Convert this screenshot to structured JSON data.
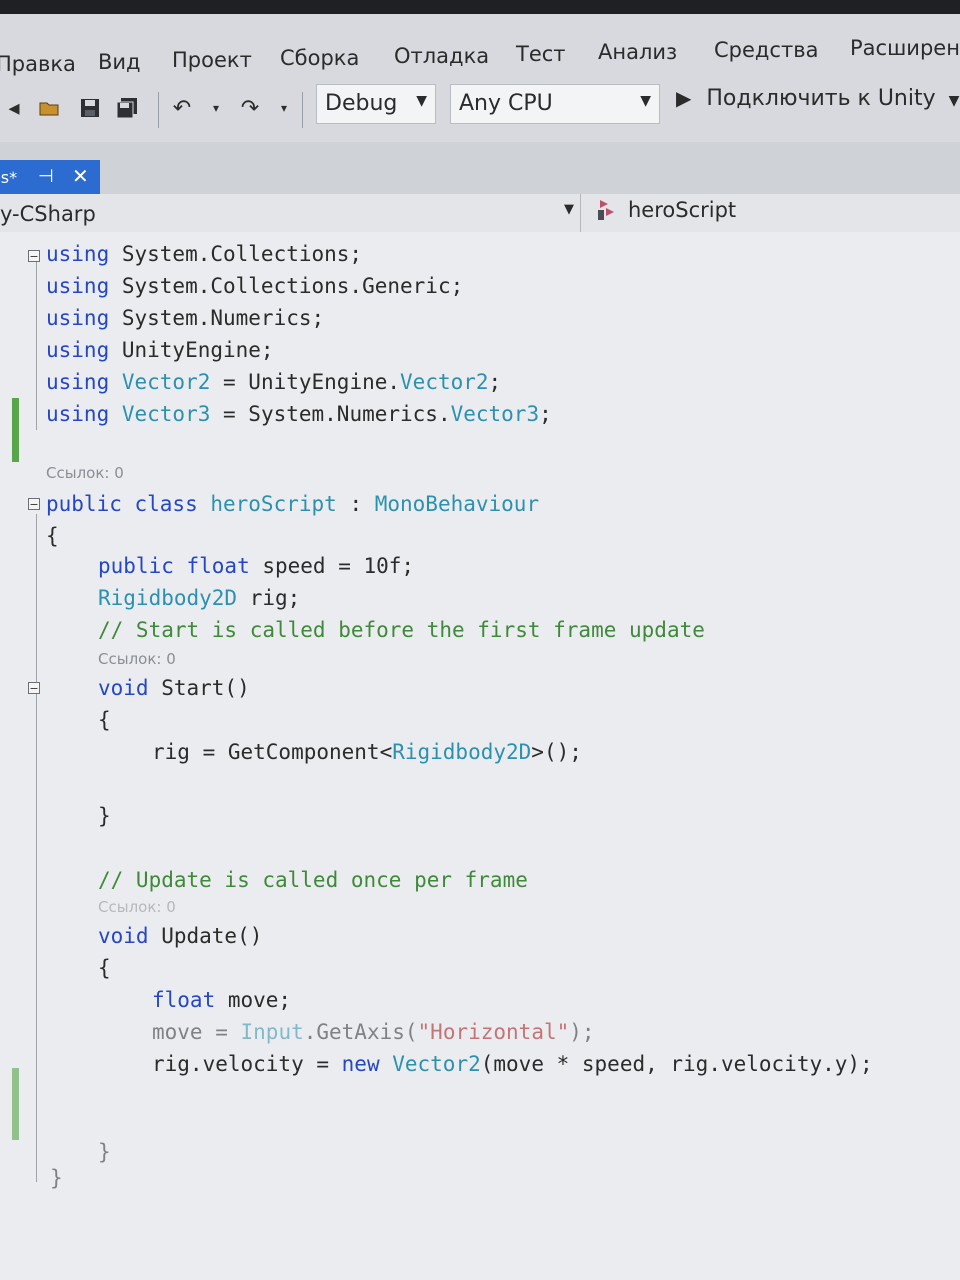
{
  "menu": {
    "items": [
      "Правка",
      "Вид",
      "Проект",
      "Сборка",
      "Отладка",
      "Тест",
      "Анализ",
      "Средства",
      "Расширен"
    ]
  },
  "toolbar": {
    "config_value": "Debug",
    "platform_value": "Any CPU",
    "run_label": "Подключить к Unity"
  },
  "tab": {
    "label": "cs*",
    "pin_icon": "pin-icon",
    "close_icon": "close-icon"
  },
  "navbar": {
    "project": "y-CSharp",
    "member": "heroScript"
  },
  "code": {
    "u1_kw": "using",
    "u1_rest": " System.Collections;",
    "u2_kw": "using",
    "u2_rest": " System.Collections.Generic;",
    "u3_kw": "using",
    "u3_rest": " System.Numerics;",
    "u4_kw": "using",
    "u4_rest": " UnityEngine;",
    "u5_kw": "using",
    "u5_alias": " Vector2",
    "u5_mid": " = UnityEngine.",
    "u5_type": "Vector2",
    "u5_end": ";",
    "u6_kw": "using",
    "u6_alias": " Vector3",
    "u6_mid": " = System.Numerics.",
    "u6_type": "Vector3",
    "u6_end": ";",
    "refs_class": "Ссылок: 0",
    "cls_kw": "public class",
    "cls_name": " heroScript",
    "cls_colon": " : ",
    "cls_base": "MonoBehaviour",
    "brace_open": "{",
    "f1_kw": "public float",
    "f1_rest": " speed = 10f;",
    "f2_type": "Rigidbody2D",
    "f2_rest": " rig;",
    "cm1": "// Start is called before the first frame update",
    "refs_start": "Ссылок: 0",
    "start_kw": "void",
    "start_rest": " Start()",
    "start_open": "{",
    "s1_a": "rig = GetComponent<",
    "s1_type": "Rigidbody2D",
    "s1_b": ">();",
    "start_close": "}",
    "cm2": "// Update is called once per frame",
    "refs_update": "Ссылок: 0",
    "upd_kw": "void",
    "upd_rest": " Update()",
    "upd_open": "{",
    "m1_kw": "float",
    "m1_rest": " move;",
    "m2_a": "move = ",
    "m2_type": "Input",
    "m2_b": ".GetAxis(",
    "m2_str": "\"Horizontal\"",
    "m2_c": ");",
    "m3_a": "rig.velocity = ",
    "m3_kw": "new",
    "m3_type": " Vector2",
    "m3_b": "(move * speed, rig.velocity.y);",
    "upd_close": "}",
    "brace_close": "}"
  },
  "colors": {
    "keyword": "#2447c4",
    "type": "#2b91af",
    "comment": "#3f8a3a",
    "string": "#a31515",
    "accent": "#2c6bd0"
  }
}
